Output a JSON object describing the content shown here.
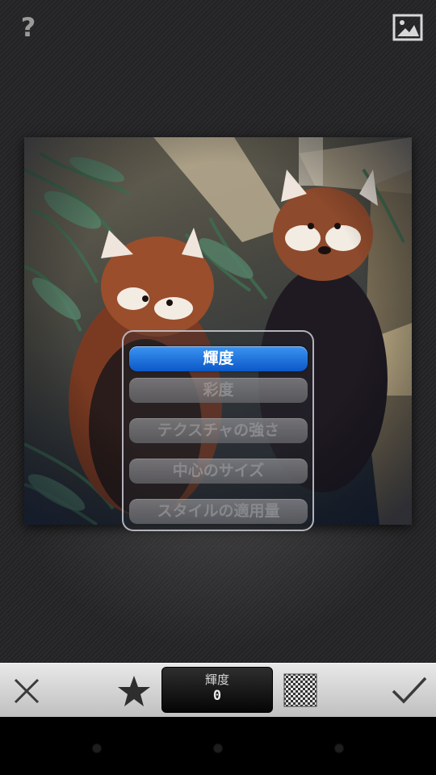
{
  "topbar": {
    "help_label": "?",
    "image_icon": "image-icon"
  },
  "photo": {
    "subject": "red-pandas-photo"
  },
  "menu": {
    "items": [
      {
        "label": "輝度",
        "active": true
      },
      {
        "label": "彩度",
        "active": false
      },
      {
        "label": "テクスチャの強さ",
        "active": false
      },
      {
        "label": "中心のサイズ",
        "active": false
      },
      {
        "label": "スタイルの適用量",
        "active": false
      }
    ]
  },
  "toolbar": {
    "cancel_icon": "close-icon",
    "favorite_icon": "star-icon",
    "param_label": "輝度",
    "param_value": "0",
    "style_icon": "checkerboard-icon",
    "apply_icon": "checkmark-icon"
  },
  "colors": {
    "accent": "#1f73df",
    "toolbar": "#d4d4d4"
  }
}
